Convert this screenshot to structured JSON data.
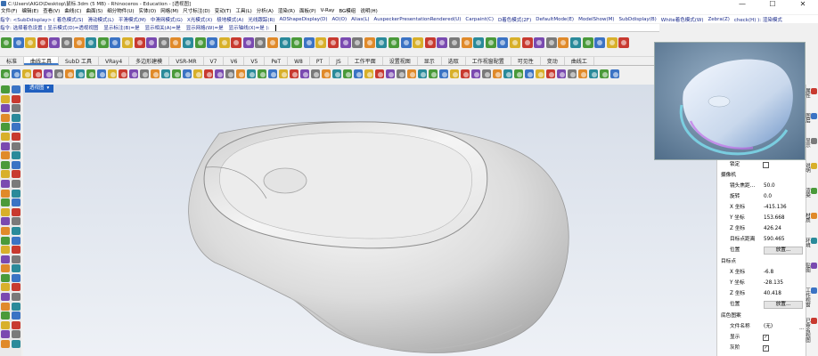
{
  "title": "C:\\Users\\AIGO\\Desktop\\鼠标.3dm (5 MB) - Rhinoceros - Education - [透视图]",
  "menus": [
    "文件(F)",
    "编辑(E)",
    "查看(V)",
    "曲线(C)",
    "曲面(S)",
    "细分物件(U)",
    "实体(O)",
    "网格(M)",
    "尺寸标注(D)",
    "变动(T)",
    "工具(L)",
    "分析(A)",
    "渲染(R)",
    "面板(P)",
    "V-Ray",
    "BG模组",
    "说明(H)"
  ],
  "command_line_1": [
    "指令: <SubDdisplay> ( 着色模式(S)",
    "滑动模式(L)",
    "平滑模式(M)",
    "中滑网模式(G)",
    "X光模式(X)",
    "极地模式(A)",
    "光线跟踪(R)",
    "ADShapeDisplay(D)",
    "AO(O)",
    "Alias(L)",
    "AuspeckerPresentationRendered(U)",
    "Carpaint(C)",
    "D着色模式(2F)",
    "DefaultMode(E)",
    "ModelShow(M)",
    "SubDdisplay(B)",
    "White着色模式(W)",
    "Zebra(Z)",
    "check(H) ): 渲染模式"
  ],
  "command_line_2": [
    "指令: 选择着色设置 ( 显示模式(D)=透视视图",
    "显示标注(B)=是",
    "显示相关(A)=是",
    "显示网格(W)=是",
    "显示轴线(X)=是 ):"
  ],
  "tabs": [
    "标准",
    "曲线工具",
    "SubD 工具",
    "VRay4",
    "多边形建模",
    "VSR-MR",
    "V7",
    "V6",
    "V5",
    "PeT",
    "W8",
    "PT",
    "JS",
    "工作平面",
    "设置视图",
    "显示",
    "选取",
    "工作视窗配置",
    "可见性",
    "变动",
    "曲线工"
  ],
  "active_tab": 1,
  "viewport_tab": "透视图",
  "viewport_dropdown": "▾",
  "window_controls": {
    "minimize": "—",
    "maximize": "☐",
    "close": "✕"
  },
  "properties": {
    "locked_label": "锁定",
    "camera_header": "摄像机",
    "camera_rows": [
      {
        "label": "镜头焦距...",
        "value": "50.0"
      },
      {
        "label": "旋转",
        "value": "0.0"
      },
      {
        "label": "X 坐标",
        "value": "-415.136"
      },
      {
        "label": "Y 坐标",
        "value": "153.668"
      },
      {
        "label": "Z 坐标",
        "value": "426.24"
      },
      {
        "label": "目标点距离",
        "value": "590.465"
      }
    ],
    "position_label": "位置",
    "place_button": "放置...",
    "target_header": "目标点",
    "target_rows": [
      {
        "label": "X 坐标",
        "value": "-6.8"
      },
      {
        "label": "Y 坐标",
        "value": "-28.135"
      },
      {
        "label": "Z 坐标",
        "value": "40.418"
      }
    ],
    "bg_header": "底色图案",
    "filename_label": "文件名称",
    "filename_value": "(无)",
    "filename_dots": "...",
    "show_label": "显示",
    "gray_label": "灰阶",
    "check": "✓"
  },
  "side_tabs": [
    "属性",
    "图层",
    "显示",
    "说明",
    "渲染",
    "材质",
    "环境",
    "贴图",
    "工作视窗",
    "已命名视图"
  ],
  "icon_colors": {
    "blue": "#3b73c4",
    "orange": "#e08a2a",
    "red": "#c83a30",
    "green": "#4a9a3a",
    "gray": "#7a7a7a",
    "yellow": "#d8b02a",
    "teal": "#2a8a9a",
    "purple": "#7a4ab0"
  }
}
